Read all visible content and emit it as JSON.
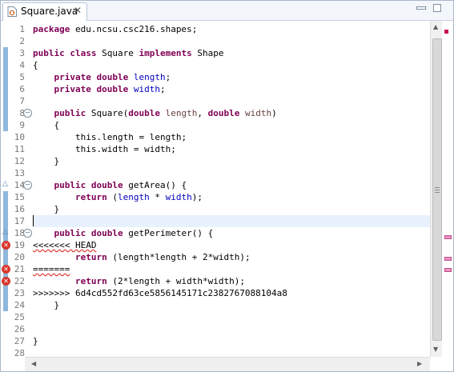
{
  "tab": {
    "label": "Square.java",
    "close": "✕",
    "icon": "java-file-icon"
  },
  "editor": {
    "line_numbers": [
      "1",
      "2",
      "3",
      "4",
      "5",
      "6",
      "7",
      "8",
      "9",
      "10",
      "11",
      "12",
      "13",
      "14",
      "15",
      "16",
      "17",
      "18",
      "19",
      "20",
      "21",
      "22",
      "23",
      "24",
      "25",
      "26",
      "27",
      "28"
    ],
    "lines": [
      "package edu.ncsu.csc216.shapes;",
      "",
      "public class Square implements Shape",
      "{",
      "    private double length;",
      "    private double width;",
      "",
      "    public Square(double length, double width)",
      "    {",
      "        this.length = length;",
      "        this.width = width;",
      "    }",
      "",
      "    public double getArea() {",
      "        return (length * width);",
      "    }",
      "",
      "    public double getPerimeter() {",
      "<<<<<<< HEAD",
      "        return (length*length + 2*width);",
      "=======",
      "        return (2*length + width*width);",
      ">>>>>>> 6d4cd552fd63ce5856145171c2382767088104a8",
      "    }",
      "",
      "",
      "}",
      ""
    ],
    "error_lines": [
      19,
      21,
      22
    ],
    "fold_lines": [
      8,
      14,
      18
    ],
    "override_lines": [
      14,
      18
    ],
    "current_line": 17
  },
  "colors": {
    "keyword": "#7f0055",
    "field": "#0000c0",
    "error": "#d9362c",
    "change_bar": "#8eb8dc"
  },
  "scrollbars": {
    "up": "▲",
    "down": "▼",
    "left": "◀",
    "right": "▶"
  },
  "overview": {
    "error_marks_lines": [
      19,
      21,
      22
    ]
  }
}
